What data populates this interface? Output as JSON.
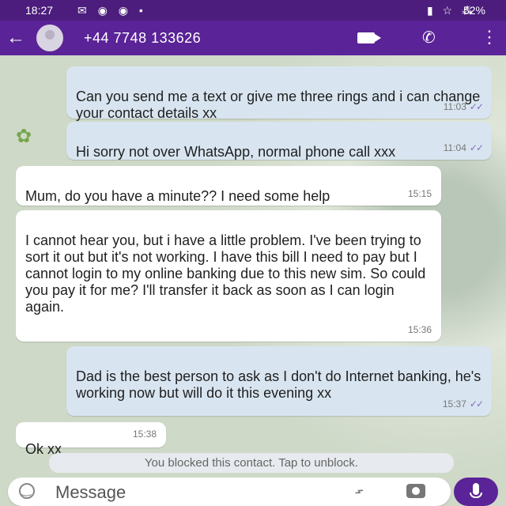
{
  "status": {
    "time": "18:27",
    "left_icons": "✉ ◉ ◉ •",
    "right_icons": "▮ ☆ ⁂",
    "battery": "52%"
  },
  "header": {
    "contact": "+44 7748 133626",
    "icons": [
      "back-arrow-icon",
      "avatar",
      "video-call-icon",
      "phone-icon",
      "more-vert-icon"
    ]
  },
  "messages": [
    {
      "direction": "out",
      "text": "Can you send me a text or give me three rings and i can change your contact details xx",
      "time": "11:03",
      "ticks": "✓✓"
    },
    {
      "direction": "out",
      "text": "Hi sorry not over WhatsApp, normal phone call xxx",
      "time": "11:04",
      "ticks": "✓✓"
    },
    {
      "direction": "in",
      "text": "Mum, do you have a minute?? I need some help",
      "time": "15:15"
    },
    {
      "direction": "in",
      "text": "I cannot hear you, but i have a little problem. I've  been trying to sort it out but it's not working. I have this bill I need to pay but I cannot login to my online banking due to this new sim. So could you pay it for me? I'll transfer it back as soon as I can login again.",
      "time": "15:36"
    },
    {
      "direction": "out",
      "text": "Dad is the best person to ask as I don't do Internet banking,  he's working now but will do it this evening xx",
      "time": "15:37",
      "ticks": "✓✓"
    },
    {
      "direction": "in",
      "text": "Ok xx",
      "time": "15:38"
    }
  ],
  "notice": "You blocked this contact. Tap to unblock.",
  "composer": {
    "placeholder": "Message",
    "icons": [
      "emoji-icon",
      "attach-icon",
      "camera-icon",
      "mic-icon"
    ]
  },
  "colors": {
    "header": "#5a2397",
    "outgoing_bubble": "#d8e5f0",
    "incoming_bubble": "#ffffff",
    "read_ticks": "#8b67c3"
  }
}
